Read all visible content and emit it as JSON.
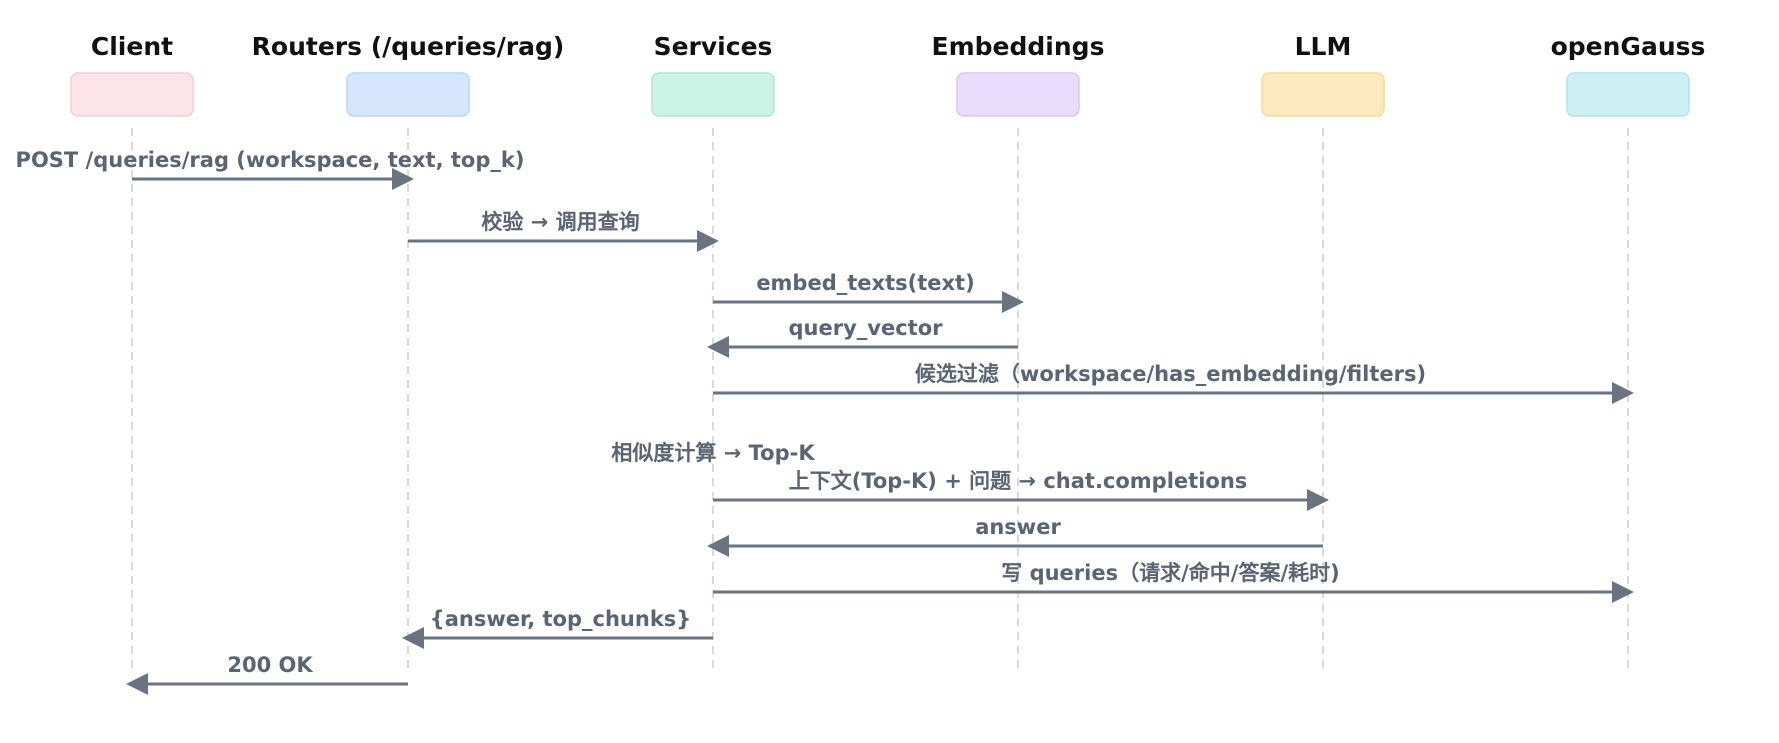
{
  "participants": [
    {
      "id": "client",
      "name": "Client",
      "fill": "#fde4ea",
      "stroke": "#f6cdd7"
    },
    {
      "id": "routers",
      "name": "Routers (/queries/rag)",
      "fill": "#d6e7fd",
      "stroke": "#bcd6f8"
    },
    {
      "id": "services",
      "name": "Services",
      "fill": "#cdf2e6",
      "stroke": "#b2e6d3"
    },
    {
      "id": "embeddings",
      "name": "Embeddings",
      "fill": "#e9dcfd",
      "stroke": "#d8c6f9"
    },
    {
      "id": "llm",
      "name": "LLM",
      "fill": "#fde9c0",
      "stroke": "#f6d9a0"
    },
    {
      "id": "opengauss",
      "name": "openGauss",
      "fill": "#cff0f2",
      "stroke": "#b3e3e7"
    }
  ],
  "messages": [
    {
      "from": "client",
      "to": "routers",
      "label": "POST /queries/rag (workspace, text, top_k)"
    },
    {
      "from": "routers",
      "to": "services",
      "label": "校验 → 调用查询"
    },
    {
      "from": "services",
      "to": "embeddings",
      "label": "embed_texts(text)"
    },
    {
      "from": "embeddings",
      "to": "services",
      "label": "query_vector"
    },
    {
      "from": "services",
      "to": "opengauss",
      "label": "候选过滤（workspace/has_embedding/filters)"
    },
    {
      "from": "services",
      "to": "services",
      "label": "相似度计算 → Top-K"
    },
    {
      "from": "services",
      "to": "llm",
      "label": "上下文(Top-K) + 问题 → chat.completions"
    },
    {
      "from": "llm",
      "to": "services",
      "label": "answer"
    },
    {
      "from": "services",
      "to": "opengauss",
      "label": "写 queries（请求/命中/答案/耗时)"
    },
    {
      "from": "services",
      "to": "routers",
      "label": "{answer, top_chunks}"
    },
    {
      "from": "routers",
      "to": "client",
      "label": "200 OK"
    }
  ],
  "colors": {
    "arrow": "#6b7280",
    "label": "#5a6472",
    "title": "#111111",
    "lifeline": "#c9cdd3"
  }
}
